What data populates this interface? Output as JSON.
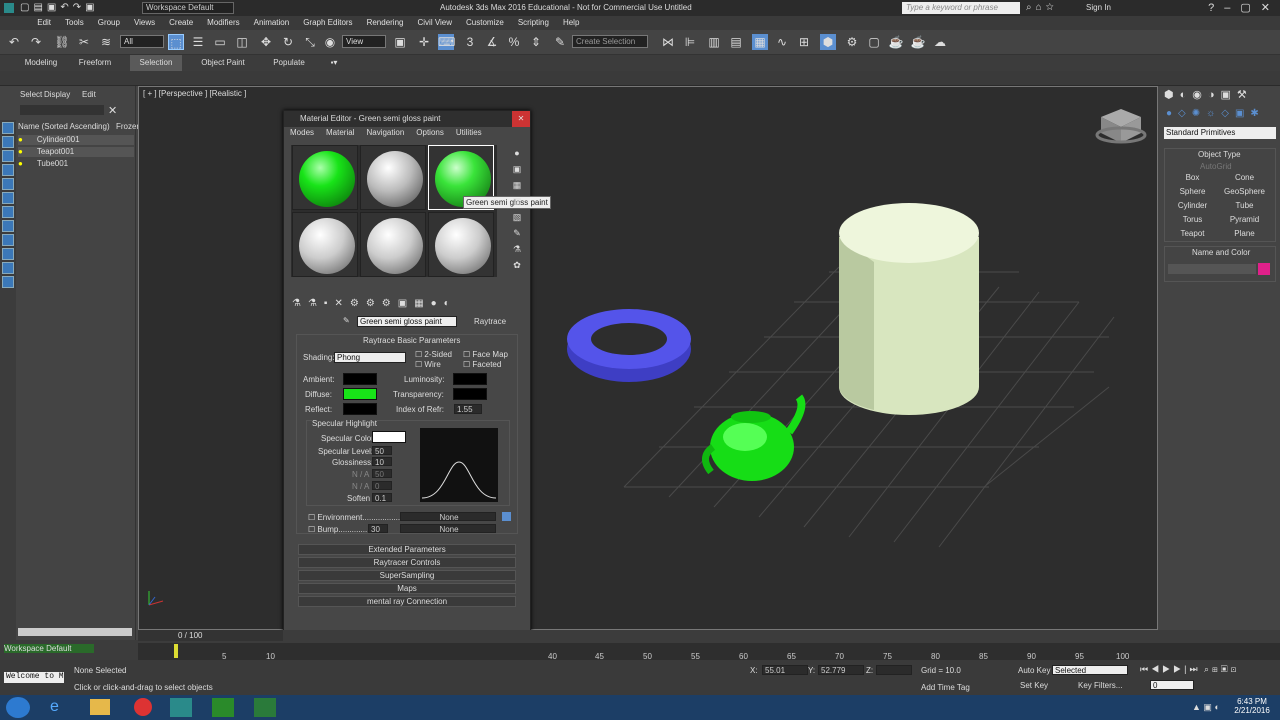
{
  "title": "Autodesk 3ds Max 2016 Educational  -  Not for Commercial Use    Untitled",
  "workspace": "Workspace Default",
  "search_placeholder": "Type a keyword or phrase",
  "sign_in": "Sign In",
  "menu": [
    "Edit",
    "Tools",
    "Group",
    "Views",
    "Create",
    "Modifiers",
    "Animation",
    "Graph Editors",
    "Rendering",
    "Civil View",
    "Customize",
    "Scripting",
    "Help"
  ],
  "toolbar": {
    "filter": "All",
    "view": "View",
    "named_selection": "Create Selection Se"
  },
  "ribbon_tabs": [
    "Modeling",
    "Freeform",
    "Selection",
    "Object Paint",
    "Populate"
  ],
  "scene": {
    "tabs": [
      "Select",
      "Display",
      "Edit"
    ],
    "col_name": "Name (Sorted Ascending)",
    "col_frozen": "Frozen",
    "items": [
      "Cylinder001",
      "Teapot001",
      "Tube001"
    ]
  },
  "viewport_label": "[ + ] [Perspective ] [Realistic ]",
  "material_editor": {
    "title": "Material Editor - Green semi gloss paint",
    "menu": [
      "Modes",
      "Material",
      "Navigation",
      "Options",
      "Utilities"
    ],
    "tooltip": "Green semi gloss paint",
    "material_name": "Green semi gloss paint",
    "material_type": "Raytrace",
    "rollout": "Raytrace Basic Parameters",
    "shading_label": "Shading:",
    "shading": "Phong",
    "two_sided": "2-Sided",
    "wire": "Wire",
    "face_map": "Face Map",
    "faceted": "Faceted",
    "ambient": "Ambient:",
    "diffuse": "Diffuse:",
    "reflect": "Reflect:",
    "luminosity": "Luminosity:",
    "transparency": "Transparency:",
    "ior_label": "Index of Refr:",
    "ior": "1.55",
    "spec_group": "Specular Highlight",
    "spec_color": "Specular Color",
    "spec_level_label": "Specular Level:",
    "spec_level": "50",
    "gloss_label": "Glossiness:",
    "gloss": "10",
    "na1": "N / A",
    "na2": "N / A",
    "na1_val": "50",
    "na2_val": "0",
    "soften_label": "Soften",
    "soften": "0.1",
    "environment": "Environment.................",
    "env_map": "None",
    "bump": "Bump.............",
    "bump_amount": "30",
    "bump_map": "None",
    "rollouts": [
      "Extended Parameters",
      "Raytracer Controls",
      "SuperSampling",
      "Maps",
      "mental ray Connection"
    ]
  },
  "cmd": {
    "dropdown": "Standard Primitives",
    "object_type": "Object Type",
    "autogrid": "AutoGrid",
    "buttons": [
      "Box",
      "Cone",
      "Sphere",
      "GeoSphere",
      "Cylinder",
      "Tube",
      "Torus",
      "Pyramid",
      "Teapot",
      "Plane"
    ],
    "name_color": "Name and Color"
  },
  "timeline": {
    "frame": "0 / 100",
    "ticks": [
      "0",
      "5",
      "10",
      "40",
      "45",
      "50",
      "55",
      "60",
      "65",
      "70",
      "75",
      "80",
      "85",
      "90",
      "95",
      "100"
    ]
  },
  "status": {
    "workspace": "Workspace Default",
    "selected": "None Selected",
    "welcome": "Welcome to M",
    "prompt": "Click or click-and-drag to select objects",
    "x_label": "X:",
    "x": "55.01",
    "y_label": "Y:",
    "y": "52.779",
    "z_label": "Z:",
    "grid": "Grid = 10.0",
    "add_time_tag": "Add Time Tag",
    "auto_key": "Auto Key",
    "set_key": "Set Key",
    "key_mode": "Selected",
    "key_filters": "Key Filters...",
    "frame": "0"
  },
  "clock": {
    "time": "6:43 PM",
    "date": "2/21/2016"
  },
  "colors": {
    "green": "#18e418",
    "torus": "#5050e8",
    "cylinder": "#e2efcc"
  }
}
